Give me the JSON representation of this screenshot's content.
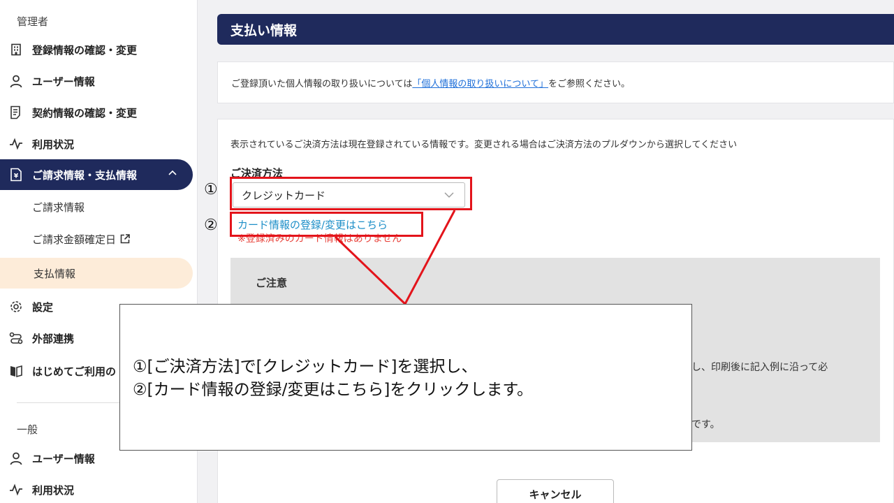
{
  "sidebar": {
    "admin_label": "管理者",
    "items": [
      {
        "label": "登録情報の確認・変更",
        "icon": "building-icon"
      },
      {
        "label": "ユーザー情報",
        "icon": "user-icon"
      },
      {
        "label": "契約情報の確認・変更",
        "icon": "document-icon"
      },
      {
        "label": "利用状況",
        "icon": "pulse-icon"
      },
      {
        "label": "ご請求情報・支払情報",
        "icon": "invoice-icon"
      }
    ],
    "sub_items": [
      {
        "label": "ご請求情報"
      },
      {
        "label": "ご請求金額確定日"
      },
      {
        "label": "支払情報"
      }
    ],
    "items2": [
      {
        "label": "設定",
        "icon": "gear-icon"
      },
      {
        "label": "外部連携",
        "icon": "link-icon"
      },
      {
        "label": "はじめてご利用の",
        "icon": "book-icon"
      }
    ],
    "general_label": "一般",
    "general_items": [
      {
        "label": "ユーザー情報",
        "icon": "user-icon"
      },
      {
        "label": "利用状況",
        "icon": "pulse-icon"
      }
    ]
  },
  "main": {
    "title": "支払い情報",
    "notice_prefix": "ご登録頂いた個人情報の取り扱いについては",
    "notice_link": "「個人情報の取り扱いについて」",
    "notice_suffix": "をご参照ください。",
    "description": "表示されているご決済方法は現在登録されている情報です。変更される場合はご決済方法のプルダウンから選択してください",
    "payment_label": "ご決済方法",
    "payment_value": "クレジットカード",
    "card_link": "カード情報の登録/変更はこちら",
    "card_warning": "※登録済みのカード情報はありません",
    "caution_title": "ご注意",
    "caution_text1": "し、印刷後に記入例に沿って必",
    "caution_text2": "です。",
    "cancel_label": "キャンセル"
  },
  "annotation": {
    "step1": "①",
    "step2": "②",
    "line1": "①[ご決済方法]で[クレジットカード]を選択し、",
    "line2": "②[カード情報の登録/変更はこちら]をクリックします。"
  },
  "colors": {
    "navy": "#1f2a5c",
    "active_sub": "#fdecd9",
    "highlight_red": "#e3141b",
    "link_blue": "#1e8fc8"
  }
}
